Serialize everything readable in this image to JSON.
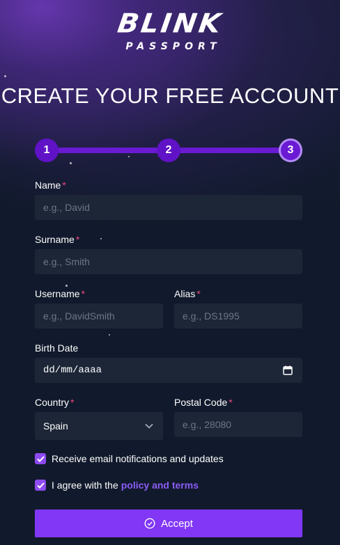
{
  "brand": {
    "name": "BLINK",
    "subtitle": "PASSPORT"
  },
  "page_title": "CREATE YOUR FREE ACCOUNT",
  "stepper": {
    "steps": [
      "1",
      "2",
      "3"
    ],
    "current": 3
  },
  "form": {
    "name": {
      "label": "Name",
      "required": "*",
      "placeholder": "e.g., David"
    },
    "surname": {
      "label": "Surname",
      "required": "*",
      "placeholder": "e.g., Smith"
    },
    "username": {
      "label": "Username",
      "required": "*",
      "placeholder": "e.g., DavidSmith"
    },
    "alias": {
      "label": "Alias",
      "required": "*",
      "placeholder": "e.g., DS1995"
    },
    "birth_date": {
      "label": "Birth Date",
      "value": "dd/mm/aaaa",
      "icon": "calendar-icon"
    },
    "country": {
      "label": "Country",
      "required": "*",
      "value": "Spain",
      "icon": "chevron-down-icon"
    },
    "postal_code": {
      "label": "Postal Code",
      "required": "*",
      "placeholder": "e.g., 28080"
    }
  },
  "checkboxes": {
    "notifications": {
      "label": "Receive email notifications and updates",
      "checked": true
    },
    "terms": {
      "label": "I agree with the",
      "link": "policy and terms",
      "checked": true
    }
  },
  "accept_button": {
    "label": "Accept",
    "icon": "check-circle-icon"
  },
  "colors": {
    "accent": "#8137f5",
    "step": "#6a1ad3",
    "required": "#e7487f",
    "background": "#111a2c",
    "input": "#1c2637"
  }
}
